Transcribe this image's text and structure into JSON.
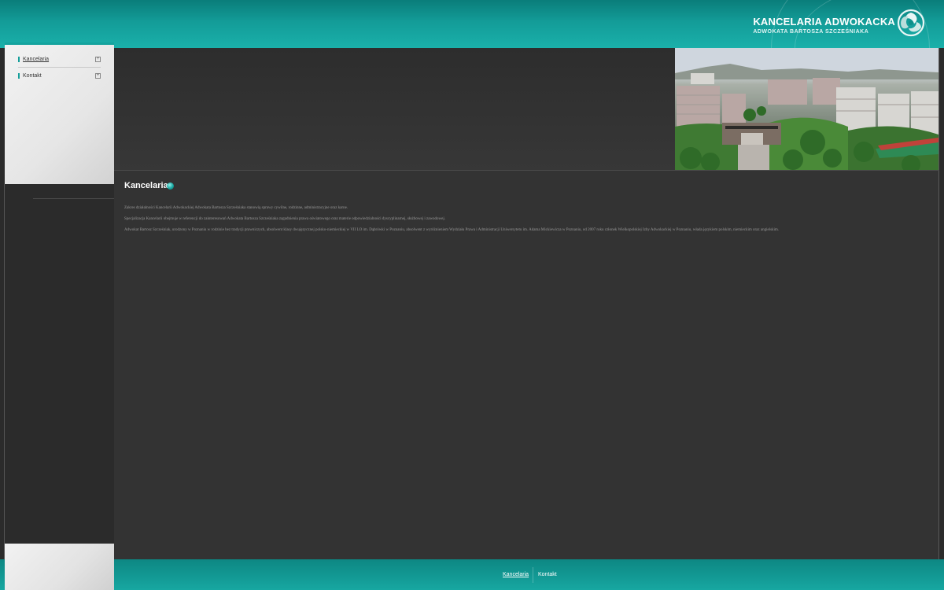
{
  "header": {
    "brand_name": "KANCELARIA ADWOKACKA",
    "brand_sub": "ADWOKATA BARTOSZA SZCZEŚNIAKA",
    "logo_icon": "triskelion-logo-icon",
    "accent_color": "#14a39e"
  },
  "sidebar": {
    "items": [
      {
        "label": "Kancelaria",
        "active": true
      },
      {
        "label": "Kontakt",
        "active": false
      }
    ]
  },
  "main": {
    "title": "Kancelaria",
    "paragraphs": [
      "Zakres działalności Kancelarii Adwokackiej Adwokata Bartosza Szcześniaka stanowią sprawy cywilne, rodzinne, administracyjne oraz karne.",
      "Specjalizacja Kancelarii obejmuje w referencji do zainteresowań Adwokata Bartosza Szcześniaka zagadnienia prawa oświatowego oraz materie odpowiedzialności dyscyplinarnej, służbowej i zawodowej.",
      "Adwokat Bartosz Szcześniak, urodzony w Poznaniu w rodzinie bez tradycji prawniczych, absolwent klasy dwujęzycznej polsko-niemieckiej w VII LO im. Dąbrówki w Poznaniu, absolwent z wyróżnieniem Wydziału Prawa i Administracji Uniwersytetu im. Adama Mickiewicza w Poznaniu, od 2007 roku członek Wielkopolskiej Izby Adwokackiej w Poznaniu, włada językiem polskim, niemieckim oraz angielskim."
    ]
  },
  "footer": {
    "links": [
      {
        "label": "Kancelaria",
        "active": true
      },
      {
        "label": "Kontakt",
        "active": false
      }
    ]
  }
}
